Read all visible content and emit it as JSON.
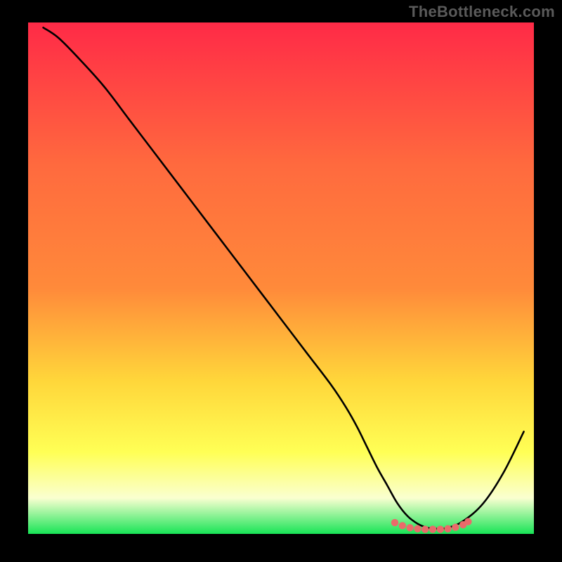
{
  "watermark": "TheBottleneck.com",
  "colors": {
    "frame_bg": "#000000",
    "watermark": "#5a5a5a",
    "curve": "#000000",
    "marker": "#ea6a6a",
    "gradient_top": "#ff2a47",
    "gradient_mid1": "#ff8a3a",
    "gradient_mid2": "#ffd63a",
    "gradient_mid3": "#ffff55",
    "gradient_mid4": "#faffd0",
    "gradient_bottom": "#18e456"
  },
  "chart_data": {
    "type": "line",
    "title": "",
    "xlabel": "",
    "ylabel": "",
    "xlim": [
      0,
      100
    ],
    "ylim": [
      0,
      100
    ],
    "grid": false,
    "legend": false,
    "notes": "Gradient background runs vertically from red (high y, bottleneck) through orange/yellow to green (low y, no bottleneck). A single black curve depicts bottleneck/mismatch percentage versus a hardware-ratio axis (x). Curve drops, reaches ~0 over a short plateau, then rises. Coral dotted markers sit on the near-zero plateau.",
    "series": [
      {
        "name": "bottleneck-curve",
        "type": "line",
        "x": [
          3,
          6,
          10,
          15,
          20,
          25,
          30,
          35,
          40,
          45,
          50,
          55,
          60,
          63,
          65,
          67,
          69,
          71,
          73,
          75,
          77,
          79,
          81,
          83,
          86,
          90,
          94,
          98
        ],
        "y": [
          99,
          97,
          93,
          87.5,
          81,
          74.5,
          68,
          61.5,
          55,
          48.5,
          42,
          35.5,
          29,
          24.5,
          21,
          17,
          13,
          9.5,
          6,
          3.5,
          2,
          1.2,
          1,
          1.2,
          2.5,
          6,
          12,
          20
        ]
      },
      {
        "name": "optimal-region-markers",
        "type": "scatter",
        "x": [
          72.5,
          74,
          75.5,
          77,
          78.5,
          80,
          81.5,
          83,
          84.5,
          86,
          87
        ],
        "y": [
          2.2,
          1.6,
          1.2,
          1.0,
          0.9,
          0.9,
          0.9,
          1.0,
          1.3,
          1.8,
          2.4
        ]
      }
    ]
  }
}
